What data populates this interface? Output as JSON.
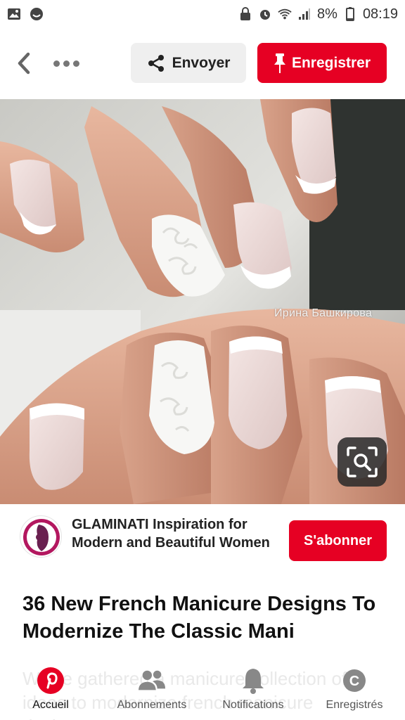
{
  "status_bar": {
    "battery": "8%",
    "time": "08:19"
  },
  "toolbar": {
    "send_label": "Envoyer",
    "save_label": "Enregistrer"
  },
  "pin": {
    "watermark": "Ирина Башкирова",
    "title": "36 New French Manicure Designs To Modernize The Classic Mani",
    "description": "We've gathered a manicure collection of ideas to modernize french manicure designs..."
  },
  "creator": {
    "name": "GLAMINATI Inspiration for Modern and Beautiful Women",
    "follow_label": "S'abonner"
  },
  "bottom_nav": {
    "items": [
      {
        "label": "Accueil",
        "icon": "pinterest-logo-icon"
      },
      {
        "label": "Abonnements",
        "icon": "people-icon"
      },
      {
        "label": "Notifications",
        "icon": "bell-icon"
      },
      {
        "label": "Enregistrés",
        "icon": "profile-c-icon"
      }
    ]
  },
  "colors": {
    "brand_red": "#e60023",
    "secondary_button": "#efefef"
  }
}
